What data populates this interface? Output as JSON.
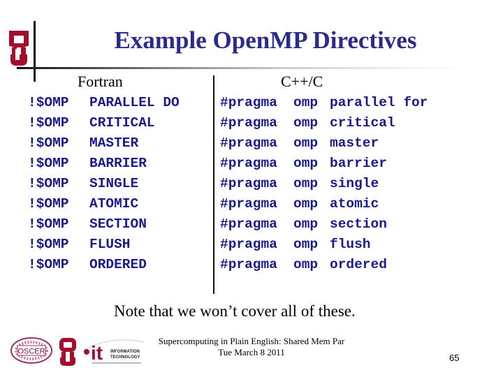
{
  "slide": {
    "title": "Example OpenMP Directives",
    "columns": {
      "fortran": {
        "heading": "Fortran",
        "rows": [
          {
            "prefix": "!$OMP",
            "directive": "PARALLEL DO"
          },
          {
            "prefix": "!$OMP",
            "directive": "CRITICAL"
          },
          {
            "prefix": "!$OMP",
            "directive": "MASTER"
          },
          {
            "prefix": "!$OMP",
            "directive": "BARRIER"
          },
          {
            "prefix": "!$OMP",
            "directive": "SINGLE"
          },
          {
            "prefix": "!$OMP",
            "directive": "ATOMIC"
          },
          {
            "prefix": "!$OMP",
            "directive": "SECTION"
          },
          {
            "prefix": "!$OMP",
            "directive": "FLUSH"
          },
          {
            "prefix": "!$OMP",
            "directive": "ORDERED"
          }
        ]
      },
      "cpp": {
        "heading": "C++/C",
        "rows": [
          {
            "pragma": "#pragma",
            "omp": "omp",
            "directive": "parallel for"
          },
          {
            "pragma": "#pragma",
            "omp": "omp",
            "directive": "critical"
          },
          {
            "pragma": "#pragma",
            "omp": "omp",
            "directive": "master"
          },
          {
            "pragma": "#pragma",
            "omp": "omp",
            "directive": "barrier"
          },
          {
            "pragma": "#pragma",
            "omp": "omp",
            "directive": "single"
          },
          {
            "pragma": "#pragma",
            "omp": "omp",
            "directive": "atomic"
          },
          {
            "pragma": "#pragma",
            "omp": "omp",
            "directive": "section"
          },
          {
            "pragma": "#pragma",
            "omp": "omp",
            "directive": "flush"
          },
          {
            "pragma": "#pragma",
            "omp": "omp",
            "directive": "ordered"
          }
        ]
      }
    },
    "note": "Note that we won’t cover all of these."
  },
  "footer": {
    "line1": "Supercomputing in Plain English: Shared Mem Par",
    "line2": "Tue March 8 2011",
    "page_number": "65",
    "logos": {
      "oscer": "OSCER",
      "it_main": "it",
      "it_line1": "INFORMATION",
      "it_line2": "TECHNOLOGY"
    }
  },
  "colors": {
    "title": "#2b2b8c",
    "code": "#1a1a8c",
    "ou_crimson": "#a50d2d"
  }
}
